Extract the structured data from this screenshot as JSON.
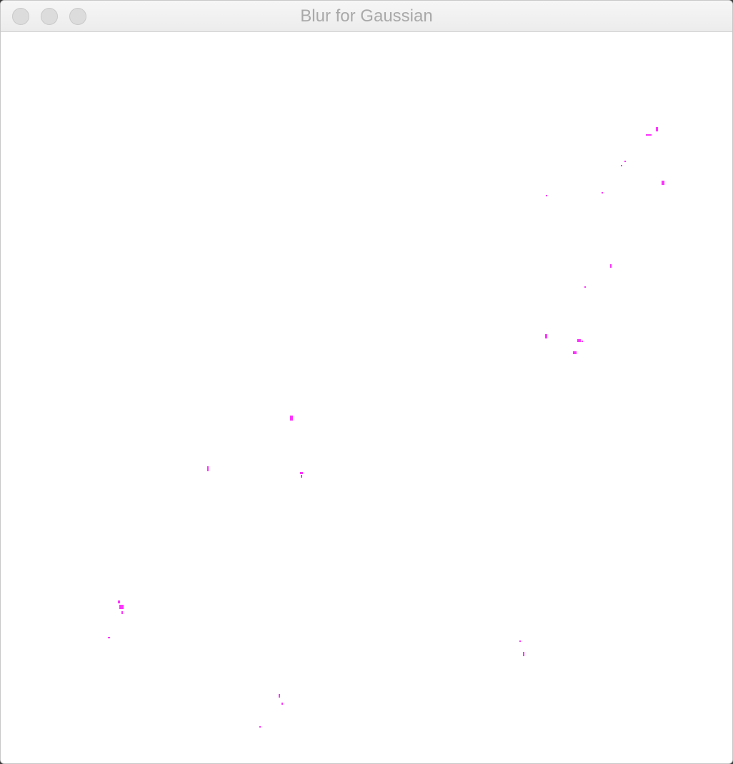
{
  "window": {
    "title": "Blur for Gaussian",
    "buttons": {
      "close_icon": "close-icon",
      "minimize_icon": "minimize-icon",
      "zoom_icon": "zoom-icon"
    }
  },
  "canvas": {
    "background": "#ffffff",
    "dot_color": "#ff33ff"
  }
}
